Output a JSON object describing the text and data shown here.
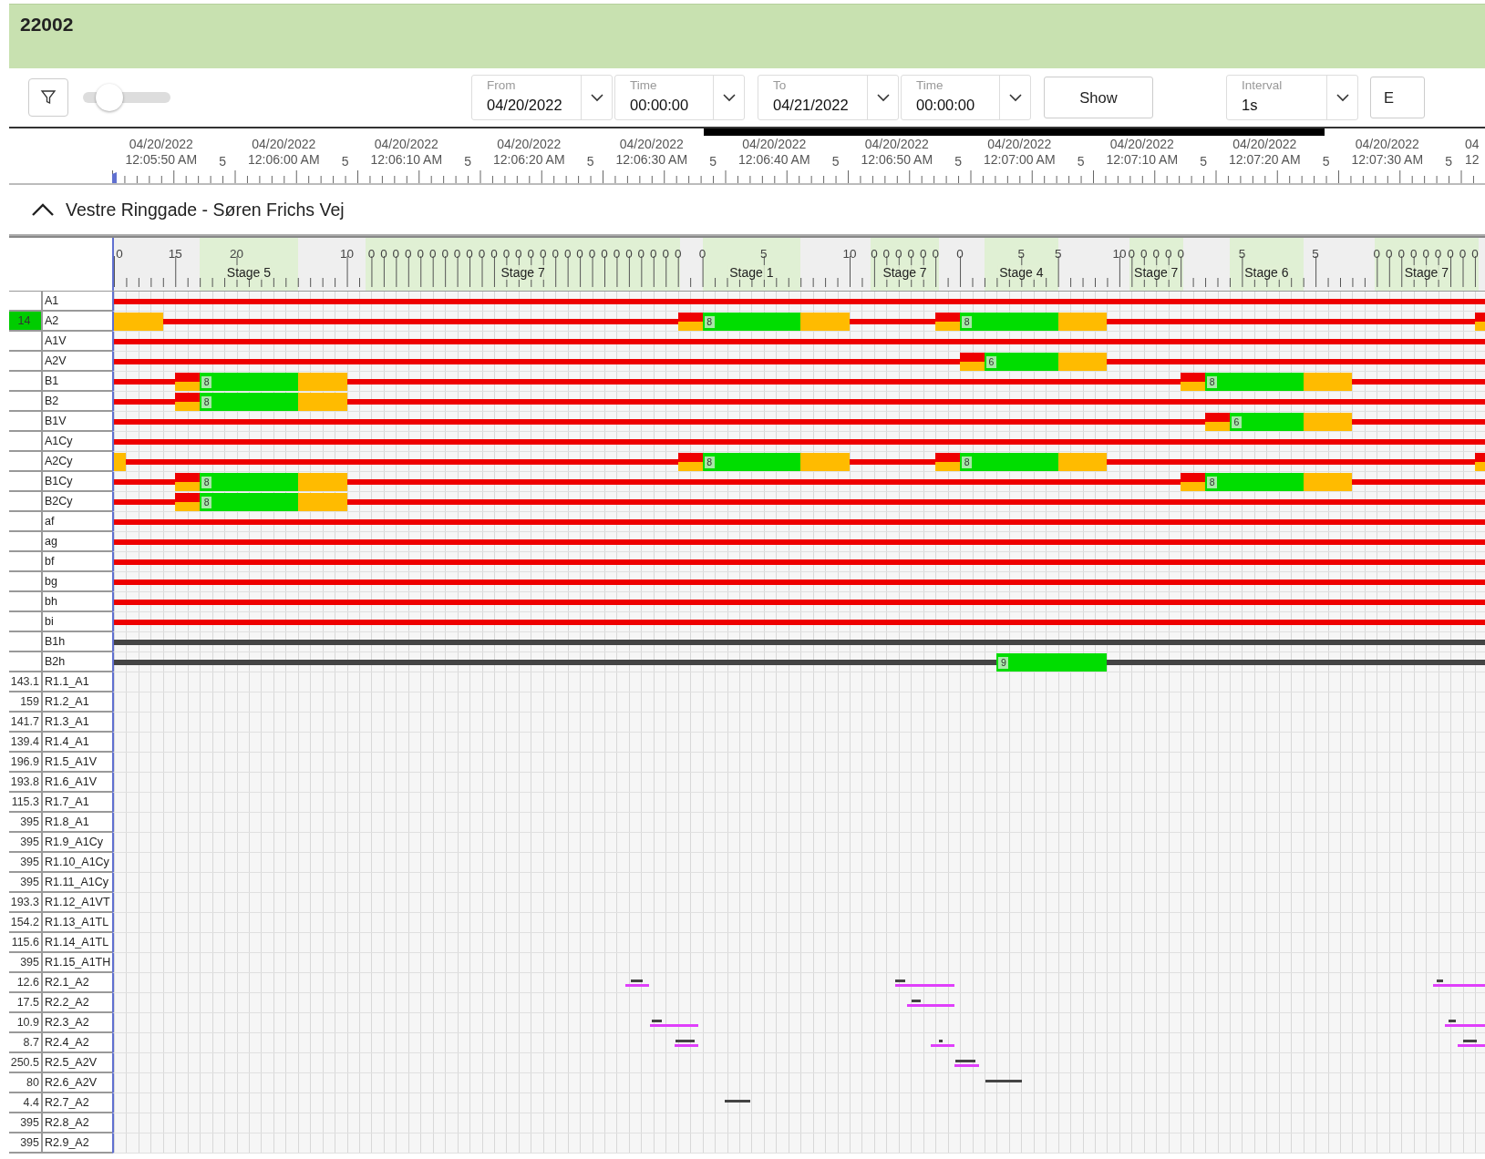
{
  "title": "22002",
  "toolbar": {
    "zoom_slider": {
      "level": 0.3
    },
    "from": {
      "label": "From",
      "value": "04/20/2022"
    },
    "from_time": {
      "label": "Time",
      "value": "00:00:00"
    },
    "to": {
      "label": "To",
      "value": "04/21/2022"
    },
    "to_time": {
      "label": "Time",
      "value": "00:00:00"
    },
    "show_button": "Show",
    "interval": {
      "label": "Interval",
      "value": "1s"
    },
    "cut_button": "E"
  },
  "timeline": {
    "labels": [
      {
        "date": "04/20/2022",
        "time": "12:05:50 AM"
      },
      {
        "date": "04/20/2022",
        "time": "12:06:00 AM"
      },
      {
        "date": "04/20/2022",
        "time": "12:06:10 AM"
      },
      {
        "date": "04/20/2022",
        "time": "12:06:20 AM"
      },
      {
        "date": "04/20/2022",
        "time": "12:06:30 AM"
      },
      {
        "date": "04/20/2022",
        "time": "12:06:40 AM"
      },
      {
        "date": "04/20/2022",
        "time": "12:06:50 AM"
      },
      {
        "date": "04/20/2022",
        "time": "12:07:00 AM"
      },
      {
        "date": "04/20/2022",
        "time": "12:07:10 AM"
      },
      {
        "date": "04/20/2022",
        "time": "12:07:20 AM"
      },
      {
        "date": "04/20/2022",
        "time": "12:07:30 AM"
      },
      {
        "date": "04",
        "time": "12"
      }
    ],
    "minor_labels": [
      "5",
      "5",
      "5",
      "5",
      "5",
      "5",
      "5",
      "5",
      "5",
      "5",
      "5"
    ]
  },
  "section": {
    "title": "Vestre Ringgade - Søren Frichs Vej",
    "expanded": true
  },
  "stage_header": {
    "stages": [
      "Stage 5",
      "Stage 7",
      "Stage 1",
      "Stage 7",
      "Stage 4",
      "Stage 7",
      "Stage 6",
      "Stage 7"
    ],
    "scale": [
      "0",
      "15",
      "20",
      "10",
      "0",
      "0",
      "0",
      "0",
      "0",
      "0",
      "0",
      "0",
      "0",
      "0",
      "0",
      "0",
      "0",
      "0",
      "0",
      "0",
      "0",
      "0",
      "0",
      "0",
      "0",
      "0",
      "0",
      "0",
      "0",
      "0",
      "0",
      "5",
      "10",
      "0",
      "0",
      "0",
      "0",
      "0",
      "0",
      "0",
      "5",
      "5",
      "10",
      "0",
      "0",
      "0",
      "0",
      "0",
      "5",
      "5",
      "0",
      "0",
      "0",
      "0",
      "0",
      "0",
      "0",
      "0",
      "0"
    ]
  },
  "signals": [
    {
      "name": "A1",
      "kind": "signal",
      "highlighted": false
    },
    {
      "name": "A2",
      "value": "14",
      "kind": "signal",
      "highlighted": true,
      "go_labels": [
        "8",
        "8"
      ]
    },
    {
      "name": "A1V",
      "kind": "signal",
      "highlighted": false
    },
    {
      "name": "A2V",
      "kind": "signal",
      "highlighted": false,
      "go_labels": [
        "6"
      ]
    },
    {
      "name": "B1",
      "kind": "signal",
      "highlighted": false,
      "go_labels": [
        "8",
        "8"
      ]
    },
    {
      "name": "B2",
      "kind": "signal",
      "highlighted": false,
      "go_labels": [
        "8"
      ]
    },
    {
      "name": "B1V",
      "kind": "signal",
      "highlighted": false,
      "go_labels": [
        "6"
      ]
    },
    {
      "name": "A1Cy",
      "kind": "signal",
      "highlighted": false
    },
    {
      "name": "A2Cy",
      "kind": "signal",
      "highlighted": false,
      "go_labels": [
        "8",
        "8"
      ]
    },
    {
      "name": "B1Cy",
      "kind": "signal",
      "highlighted": false,
      "go_labels": [
        "8",
        "8"
      ]
    },
    {
      "name": "B2Cy",
      "kind": "signal",
      "highlighted": false,
      "go_labels": [
        "8"
      ]
    },
    {
      "name": "af",
      "kind": "signal",
      "highlighted": false
    },
    {
      "name": "ag",
      "kind": "signal",
      "highlighted": false
    },
    {
      "name": "bf",
      "kind": "signal",
      "highlighted": false
    },
    {
      "name": "bg",
      "kind": "signal",
      "highlighted": false
    },
    {
      "name": "bh",
      "kind": "signal",
      "highlighted": false
    },
    {
      "name": "bi",
      "kind": "signal",
      "highlighted": false
    },
    {
      "name": "B1h",
      "kind": "hold",
      "highlighted": false
    },
    {
      "name": "B2h",
      "kind": "hold",
      "highlighted": false,
      "go_labels": [
        "9"
      ]
    }
  ],
  "detectors": [
    {
      "value": "143.1",
      "name": "R1.1_A1"
    },
    {
      "value": "159",
      "name": "R1.2_A1"
    },
    {
      "value": "141.7",
      "name": "R1.3_A1"
    },
    {
      "value": "139.4",
      "name": "R1.4_A1"
    },
    {
      "value": "196.9",
      "name": "R1.5_A1V"
    },
    {
      "value": "193.8",
      "name": "R1.6_A1V"
    },
    {
      "value": "115.3",
      "name": "R1.7_A1"
    },
    {
      "value": "395",
      "name": "R1.8_A1"
    },
    {
      "value": "395",
      "name": "R1.9_A1Cy"
    },
    {
      "value": "395",
      "name": "R1.10_A1Cy"
    },
    {
      "value": "395",
      "name": "R1.11_A1Cy"
    },
    {
      "value": "193.3",
      "name": "R1.12_A1VT"
    },
    {
      "value": "154.2",
      "name": "R1.13_A1TL"
    },
    {
      "value": "115.6",
      "name": "R1.14_A1TL"
    },
    {
      "value": "395",
      "name": "R1.15_A1TH"
    },
    {
      "value": "12.6",
      "name": "R2.1_A2"
    },
    {
      "value": "17.5",
      "name": "R2.2_A2"
    },
    {
      "value": "10.9",
      "name": "R2.3_A2"
    },
    {
      "value": "8.7",
      "name": "R2.4_A2"
    },
    {
      "value": "250.5",
      "name": "R2.5_A2V"
    },
    {
      "value": "80",
      "name": "R2.6_A2V"
    },
    {
      "value": "4.4",
      "name": "R2.7_A2"
    },
    {
      "value": "395",
      "name": "R2.8_A2"
    },
    {
      "value": "395",
      "name": "R2.9_A2"
    }
  ]
}
